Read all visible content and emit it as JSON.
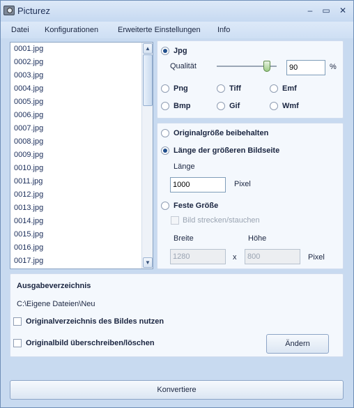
{
  "window": {
    "title": "Picturez"
  },
  "titlebar_buttons": {
    "minimize": "‒",
    "maximize": "▭",
    "close": "✕"
  },
  "menu": [
    "Datei",
    "Konfigurationen",
    "Erweiterte Einstellungen",
    "Info"
  ],
  "files": [
    "0001.jpg",
    "0002.jpg",
    "0003.jpg",
    "0004.jpg",
    "0005.jpg",
    "0006.jpg",
    "0007.jpg",
    "0008.jpg",
    "0009.jpg",
    "0010.jpg",
    "0011.jpg",
    "0012.jpg",
    "0013.jpg",
    "0014.jpg",
    "0015.jpg",
    "0016.jpg",
    "0017.jpg"
  ],
  "format": {
    "jpg_label": "Jpg",
    "quality_label": "Qualität",
    "quality_value": "90",
    "quality_unit": "%",
    "options": [
      "Png",
      "Tiff",
      "Emf",
      "Bmp",
      "Gif",
      "Wmf"
    ],
    "selected": "Jpg"
  },
  "size": {
    "keep_original": "Originalgröße beibehalten",
    "longer_side": "Länge der größeren Bildseite",
    "length_label": "Länge",
    "length_value": "1000",
    "length_unit": "Pixel",
    "fixed_size": "Feste Größe",
    "stretch": "Bild strecken/stauchen",
    "width_label": "Breite",
    "height_label": "Höhe",
    "width_value": "1280",
    "height_value": "800",
    "x_sep": "x",
    "fixed_unit": "Pixel",
    "selected": "Länge der größeren Bildseite"
  },
  "output": {
    "title": "Ausgabeverzeichnis",
    "path": "C:\\Eigene Dateien\\Neu",
    "use_original_dir": "Originalverzeichnis des Bildes nutzen",
    "overwrite": "Originalbild überschreiben/löschen",
    "change_button": "Ändern"
  },
  "convert_button": "Konvertiere"
}
